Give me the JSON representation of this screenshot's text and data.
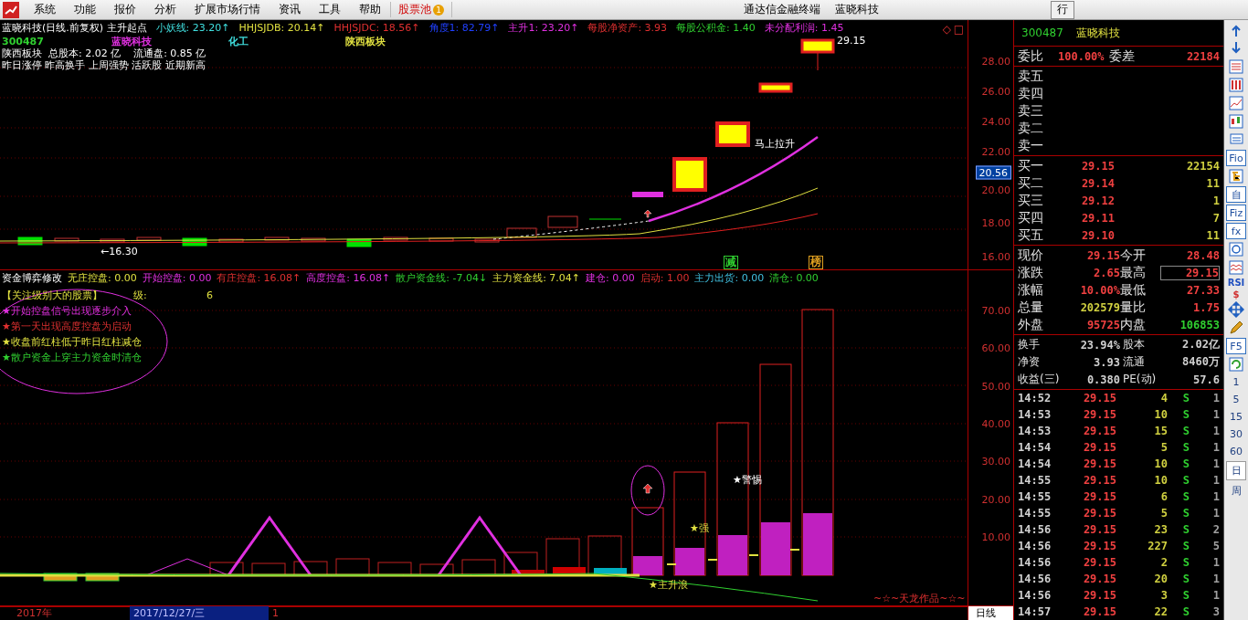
{
  "menu": {
    "items": [
      "系统",
      "功能",
      "报价",
      "分析",
      "扩展市场行情",
      "资讯",
      "工具",
      "帮助"
    ],
    "pool": {
      "label": "股票池",
      "badge": "1"
    },
    "titles": [
      "通达信金融终端",
      "蓝晓科技"
    ],
    "right_button": "行"
  },
  "upper": {
    "title": "蓝晓科技(日线.前复权) 主升起点",
    "indicators": [
      {
        "label": "小妖线: ",
        "value": "23.20↑",
        "color": "#40e0e0"
      },
      {
        "label": "HHJSJDB: ",
        "value": "20.14↑",
        "color": "#e0e040"
      },
      {
        "label": "HHJSJDC: ",
        "value": "18.56↑",
        "color": "#e03030"
      },
      {
        "label": "角度1: ",
        "value": "82.79↑",
        "color": "#2040ff"
      },
      {
        "label": "主升1: ",
        "value": "23.20↑",
        "color": "#e030e0"
      },
      {
        "label": "每股净资产: ",
        "value": "3.93",
        "color": "#e03030"
      },
      {
        "label": "每股公积金: ",
        "value": "1.40",
        "color": "#30d030"
      },
      {
        "label": "未分配利润: ",
        "value": "1.45",
        "color": "#e030e0"
      }
    ],
    "tags": [
      {
        "text": "300487",
        "color": "#30d030"
      },
      {
        "text": "蓝晓科技",
        "color": "#e030e0"
      },
      {
        "text": "化工",
        "color": "#40e0e0"
      },
      {
        "text": "陕西板块",
        "color": "#e0e040"
      }
    ],
    "info_lines": [
      "陕西板块  总股本: 2.02 亿    流通盘: 0.85 亿",
      "昨日涨停 昨高换手 上周强势 活跃股 近期新高"
    ],
    "corner_marks": [
      "◇",
      "□"
    ],
    "annotations": [
      {
        "kind": "price",
        "text": "29.15"
      },
      {
        "kind": "note",
        "text": "马上拉升"
      },
      {
        "kind": "low",
        "text": "←16.30"
      },
      {
        "kind": "tag",
        "text": "减",
        "color": "#30d030"
      },
      {
        "kind": "tag",
        "text": "榜",
        "color": "#e0a020"
      }
    ],
    "axis": [
      "28.00",
      "26.00",
      "24.00",
      "22.00",
      "20.00",
      "18.00",
      "16.00"
    ],
    "current_price": "20.56"
  },
  "lower": {
    "title": "资金博弈修改",
    "indicators": [
      {
        "label": "无庄控盘: ",
        "value": "0.00",
        "color": "#e0e040"
      },
      {
        "label": "开始控盘: ",
        "value": "0.00",
        "color": "#e030e0"
      },
      {
        "label": "有庄控盘: ",
        "value": "16.08↑",
        "color": "#e03030"
      },
      {
        "label": "高度控盘: ",
        "value": "16.08↑",
        "color": "#e030e0"
      },
      {
        "label": "散户资金线: ",
        "value": "-7.04↓",
        "color": "#30d030"
      },
      {
        "label": "主力资金线: ",
        "value": "7.04↑",
        "color": "#e0e040"
      },
      {
        "label": "建仓: ",
        "value": "0.00",
        "color": "#e030e0"
      },
      {
        "label": "启动: ",
        "value": "1.00",
        "color": "#e03030"
      },
      {
        "label": "主力出货: ",
        "value": "0.00",
        "color": "#40c0e0"
      },
      {
        "label": "清仓: ",
        "value": "0.00",
        "color": "#30d030"
      }
    ],
    "focus": {
      "label": "【关注级别大的股票】",
      "level_label": "级:",
      "level_value": "6"
    },
    "rules": [
      {
        "text": "★开始控盘信号出现逐步介入",
        "color": "#e030e0"
      },
      {
        "text": "★第一天出现高度控盘为启动",
        "color": "#e03030"
      },
      {
        "text": "★收盘前红柱低于昨日红柱减仓",
        "color": "#e0e040"
      },
      {
        "text": "★散户资金上穿主力资金时清仓",
        "color": "#30d030"
      }
    ],
    "annotations": [
      {
        "kind": "warn",
        "text": "★警惕"
      },
      {
        "kind": "strong",
        "text": "★强"
      },
      {
        "kind": "wave",
        "text": "★主升浪"
      },
      {
        "kind": "credit",
        "text": "~☆~天龙作品~☆~"
      }
    ],
    "axis": [
      "70.00",
      "60.00",
      "50.00",
      "40.00",
      "30.00",
      "20.00",
      "10.00"
    ]
  },
  "time_bar": {
    "year": "2017年",
    "date": "2017/12/27/三",
    "cursor": "1",
    "period": "日线"
  },
  "quote": {
    "header": {
      "code": "300487",
      "name": "蓝晓科技"
    },
    "ratio": {
      "label": "委比",
      "value": "100.00%",
      "label2": "委差",
      "value2": "22184"
    },
    "sells": [
      "卖五",
      "卖四",
      "卖三",
      "卖二",
      "卖一"
    ],
    "buys": [
      {
        "label": "买一",
        "price": "29.15",
        "volume": "22154"
      },
      {
        "label": "买二",
        "price": "29.14",
        "volume": "11"
      },
      {
        "label": "买三",
        "price": "29.12",
        "volume": "1"
      },
      {
        "label": "买四",
        "price": "29.11",
        "volume": "7"
      },
      {
        "label": "买五",
        "price": "29.10",
        "volume": "11"
      }
    ],
    "stats": [
      {
        "l1": "现价",
        "v1": "29.15",
        "l2": "今开",
        "v2": "28.48"
      },
      {
        "l1": "涨跌",
        "v1": "2.65",
        "l2": "最高",
        "v2": "29.15"
      },
      {
        "l1": "涨幅",
        "v1": "10.00%",
        "l2": "最低",
        "v2": "27.33"
      },
      {
        "l1": "总量",
        "v1": "202579",
        "l2": "量比",
        "v2": "1.75"
      },
      {
        "l1": "外盘",
        "v1": "95725",
        "l2": "内盘",
        "v2": "106853"
      }
    ],
    "fundamentals": [
      {
        "l1": "换手",
        "v1": "23.94%",
        "l2": "股本",
        "v2": "2.02亿"
      },
      {
        "l1": "净资",
        "v1": "3.93",
        "l2": "流通",
        "v2": "8460万"
      },
      {
        "l1": "收益(三)",
        "v1": "0.380",
        "l2": "PE(动)",
        "v2": "57.6"
      }
    ],
    "trades": [
      {
        "time": "14:52",
        "price": "29.15",
        "volume": "4",
        "side": "S",
        "count": "1"
      },
      {
        "time": "14:53",
        "price": "29.15",
        "volume": "10",
        "side": "S",
        "count": "1"
      },
      {
        "time": "14:53",
        "price": "29.15",
        "volume": "15",
        "side": "S",
        "count": "1"
      },
      {
        "time": "14:54",
        "price": "29.15",
        "volume": "5",
        "side": "S",
        "count": "1"
      },
      {
        "time": "14:54",
        "price": "29.15",
        "volume": "10",
        "side": "S",
        "count": "1"
      },
      {
        "time": "14:55",
        "price": "29.15",
        "volume": "10",
        "side": "S",
        "count": "1"
      },
      {
        "time": "14:55",
        "price": "29.15",
        "volume": "6",
        "side": "S",
        "count": "1"
      },
      {
        "time": "14:55",
        "price": "29.15",
        "volume": "5",
        "side": "S",
        "count": "1"
      },
      {
        "time": "14:56",
        "price": "29.15",
        "volume": "23",
        "side": "S",
        "count": "2"
      },
      {
        "time": "14:56",
        "price": "29.15",
        "volume": "227",
        "side": "S",
        "count": "5"
      },
      {
        "time": "14:56",
        "price": "29.15",
        "volume": "2",
        "side": "S",
        "count": "1"
      },
      {
        "time": "14:56",
        "price": "29.15",
        "volume": "20",
        "side": "S",
        "count": "1"
      },
      {
        "time": "14:56",
        "price": "29.15",
        "volume": "3",
        "side": "S",
        "count": "1"
      },
      {
        "time": "14:57",
        "price": "29.15",
        "volume": "22",
        "side": "S",
        "count": "3"
      }
    ]
  },
  "toolbar": [
    {
      "kind": "icon"
    },
    {
      "kind": "icon"
    },
    {
      "kind": "icon"
    },
    {
      "kind": "icon"
    },
    {
      "kind": "icon"
    },
    {
      "kind": "icon"
    },
    {
      "kind": "icon"
    },
    {
      "kind": "boxed",
      "text": "Fio"
    },
    {
      "kind": "icon"
    },
    {
      "kind": "boxed",
      "text": "自"
    },
    {
      "kind": "boxed",
      "text": "Fiz"
    },
    {
      "kind": "boxed",
      "text": "fx"
    },
    {
      "kind": "icon"
    },
    {
      "kind": "icon"
    },
    {
      "kind": "bold",
      "text": "RSI"
    },
    {
      "kind": "bold",
      "text": "$"
    },
    {
      "kind": "icon"
    },
    {
      "kind": "icon"
    },
    {
      "kind": "boxed",
      "text": "F5"
    },
    {
      "kind": "icon"
    },
    {
      "kind": "period",
      "text": "1",
      "selected": false
    },
    {
      "kind": "period",
      "text": "5",
      "selected": false
    },
    {
      "kind": "period",
      "text": "15",
      "selected": false
    },
    {
      "kind": "period",
      "text": "30",
      "selected": false
    },
    {
      "kind": "period",
      "text": "60",
      "selected": false
    },
    {
      "kind": "period",
      "text": "日",
      "selected": true
    },
    {
      "kind": "period",
      "text": "周",
      "selected": false
    }
  ]
}
